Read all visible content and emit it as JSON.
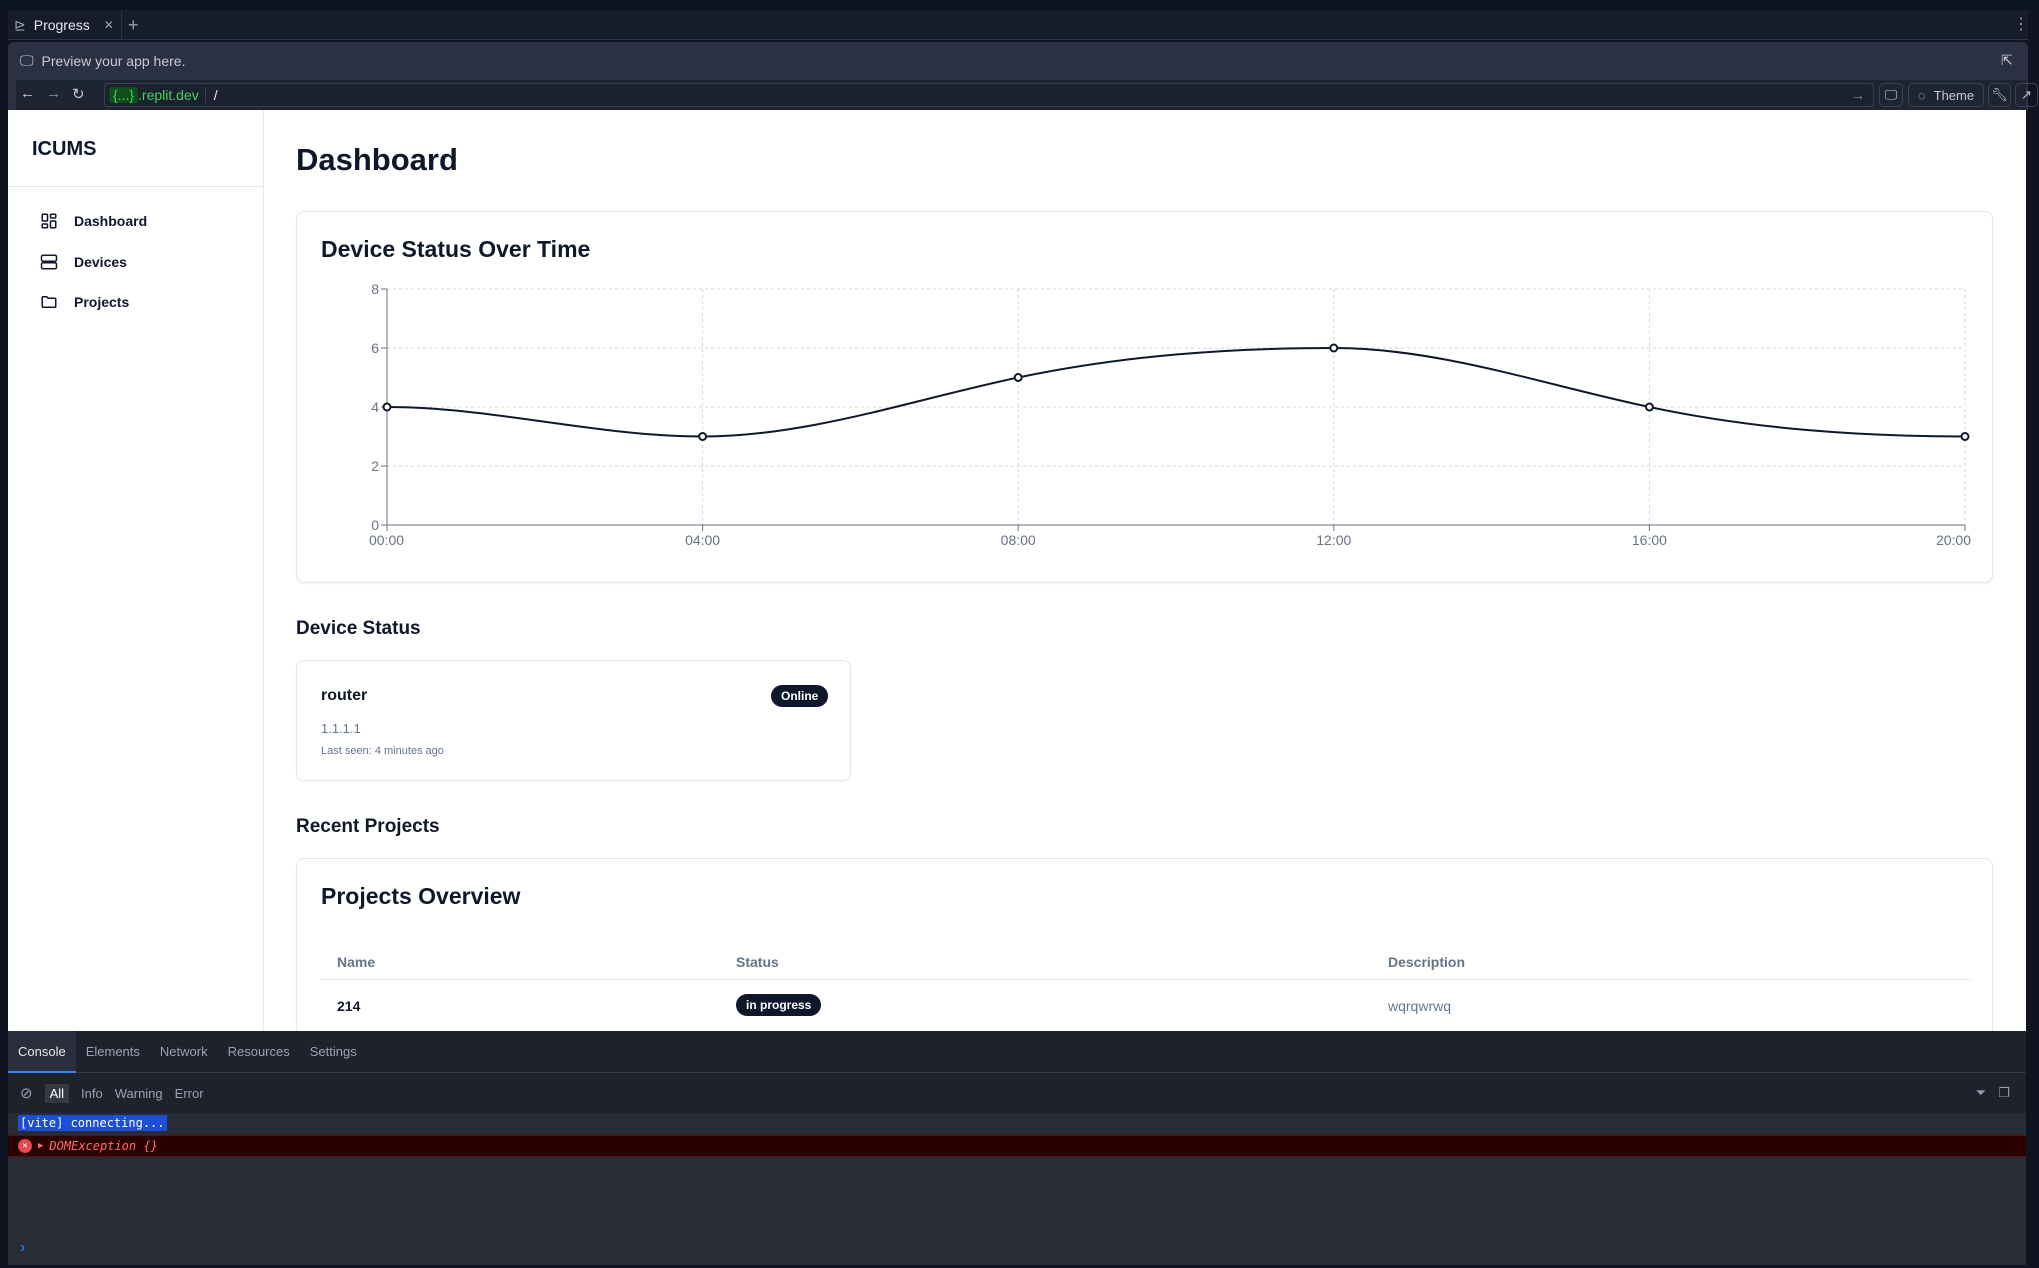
{
  "browser": {
    "tab_title": "Progress",
    "preview_text": "Preview your app here.",
    "url_domain_token": "{...}",
    "url_domain": ".replit.dev",
    "url_path": "/",
    "theme_label": "Theme"
  },
  "sidebar": {
    "brand": "ICUMS",
    "items": [
      {
        "label": "Dashboard"
      },
      {
        "label": "Devices"
      },
      {
        "label": "Projects"
      }
    ]
  },
  "main": {
    "title": "Dashboard",
    "device_status_heading": "Device Status",
    "devices": [
      {
        "name": "router",
        "ip": "1.1.1.1",
        "last_seen": "Last seen: 4 minutes ago",
        "status": "Online"
      }
    ],
    "recent_projects_heading": "Recent Projects",
    "projects": {
      "title": "Projects Overview",
      "columns": [
        "Name",
        "Status",
        "Description"
      ],
      "rows": [
        {
          "name": "214",
          "status": "in progress",
          "description": "wqrqwrwq"
        }
      ]
    }
  },
  "chart_data": {
    "type": "line",
    "title": "Device Status Over Time",
    "categories": [
      "00:00",
      "04:00",
      "08:00",
      "12:00",
      "16:00",
      "20:00"
    ],
    "values": [
      4,
      3,
      5,
      6,
      4,
      3
    ],
    "ylim": [
      0,
      8
    ],
    "yticks": [
      "0",
      "2",
      "4",
      "6",
      "8"
    ],
    "grid": true,
    "line_color": "#0f172a"
  },
  "devtools": {
    "tabs": [
      "Console",
      "Elements",
      "Network",
      "Resources",
      "Settings"
    ],
    "filters": [
      "All",
      "Info",
      "Warning",
      "Error"
    ],
    "logs": [
      "[vite] connecting...",
      "DOMException {}"
    ]
  }
}
